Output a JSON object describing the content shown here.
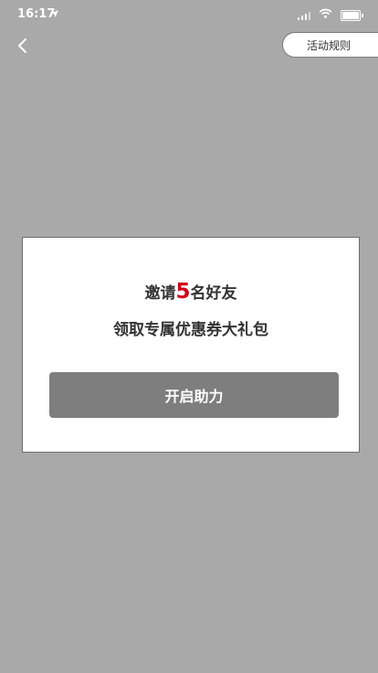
{
  "status_bar": {
    "time": "16:17"
  },
  "header": {
    "rules_label": "活动规则"
  },
  "dialog": {
    "line1_prefix": "邀请",
    "line1_number": "5",
    "line1_suffix": "名好友",
    "line2": "领取专属优惠券大礼包",
    "button_label": "开启助力"
  },
  "colors": {
    "background": "#a9a9a9",
    "accent_number": "#d0021b",
    "button": "#7e7e7e"
  }
}
